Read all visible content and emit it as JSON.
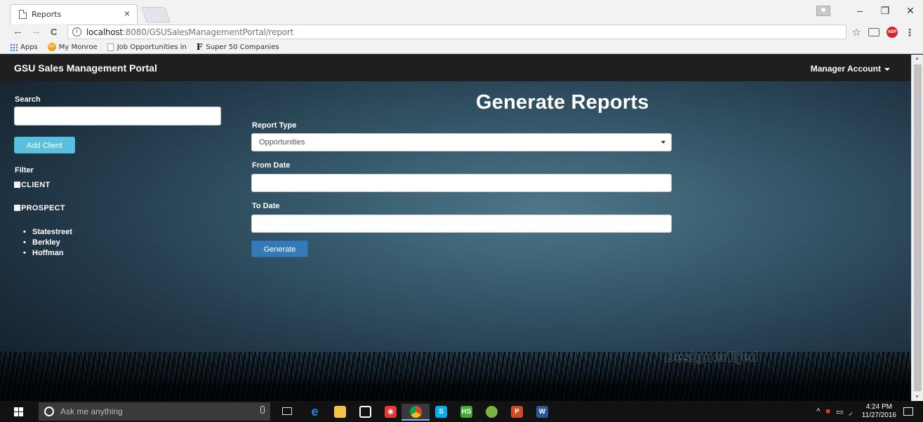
{
  "browser": {
    "tab_title": "Reports",
    "tab_close": "×",
    "url_host": "localhost",
    "url_rest": ":8080/GSUSalesManagementPortal/report",
    "info_glyph": "i",
    "window_controls": {
      "minimize": "–",
      "restore": "❐",
      "close": "✕"
    },
    "nav": {
      "back": "←",
      "forward": "→",
      "reload": "C"
    },
    "star": "☆",
    "menu": "⋮",
    "abp_label": "ABP"
  },
  "bookmarks": [
    {
      "label": "Apps",
      "icon": "apps-grid-icon"
    },
    {
      "label": "My Monroe",
      "icon": "monroe-icon",
      "badge": "MY"
    },
    {
      "label": "Job Opportunities in",
      "icon": "page-icon"
    },
    {
      "label": "Super 50 Companies",
      "icon": "forbes-icon",
      "glyph": "F"
    }
  ],
  "navbar": {
    "brand": "GSU Sales Management Portal",
    "account": "Manager Account"
  },
  "sidebar": {
    "search_label": "Search",
    "search_value": "",
    "add_client_label": "Add Client",
    "filter_label": "Filter",
    "filters": [
      {
        "label": "CLIENT",
        "checked": false
      },
      {
        "label": "PROSPECT",
        "checked": false
      }
    ],
    "prospects": [
      "Statestreet",
      "Berkley",
      "Hoffman"
    ]
  },
  "form": {
    "heading": "Generate Reports",
    "report_type_label": "Report Type",
    "report_type_value": "Opportunities",
    "from_date_label": "From Date",
    "from_date_value": "",
    "to_date_label": "To Date",
    "to_date_value": "",
    "generate_label": "Generate"
  },
  "watermark": "DesignerEjed",
  "taskbar": {
    "search_placeholder": "Ask me anything",
    "apps": [
      {
        "name": "edge-icon",
        "glyph": "e",
        "color": "#1e88e5"
      },
      {
        "name": "file-explorer-icon",
        "glyph": "",
        "color": "#f4c542"
      },
      {
        "name": "store-icon",
        "glyph": "",
        "color": "#ffffff"
      },
      {
        "name": "media-app-icon",
        "glyph": "◉",
        "color": "#e53935"
      },
      {
        "name": "chrome-icon",
        "glyph": "",
        "color": "#fbbc05"
      },
      {
        "name": "skype-icon",
        "glyph": "S",
        "color": "#00aff0"
      },
      {
        "name": "hootsuite-icon",
        "glyph": "HS",
        "color": "#3dae2b"
      },
      {
        "name": "green-app-icon",
        "glyph": "",
        "color": "#7cb342"
      },
      {
        "name": "powerpoint-icon",
        "glyph": "P",
        "color": "#d24726"
      },
      {
        "name": "word-icon",
        "glyph": "W",
        "color": "#2b579a"
      }
    ],
    "tray_glyph": "^",
    "time": "4:24 PM",
    "date": "11/27/2016"
  }
}
